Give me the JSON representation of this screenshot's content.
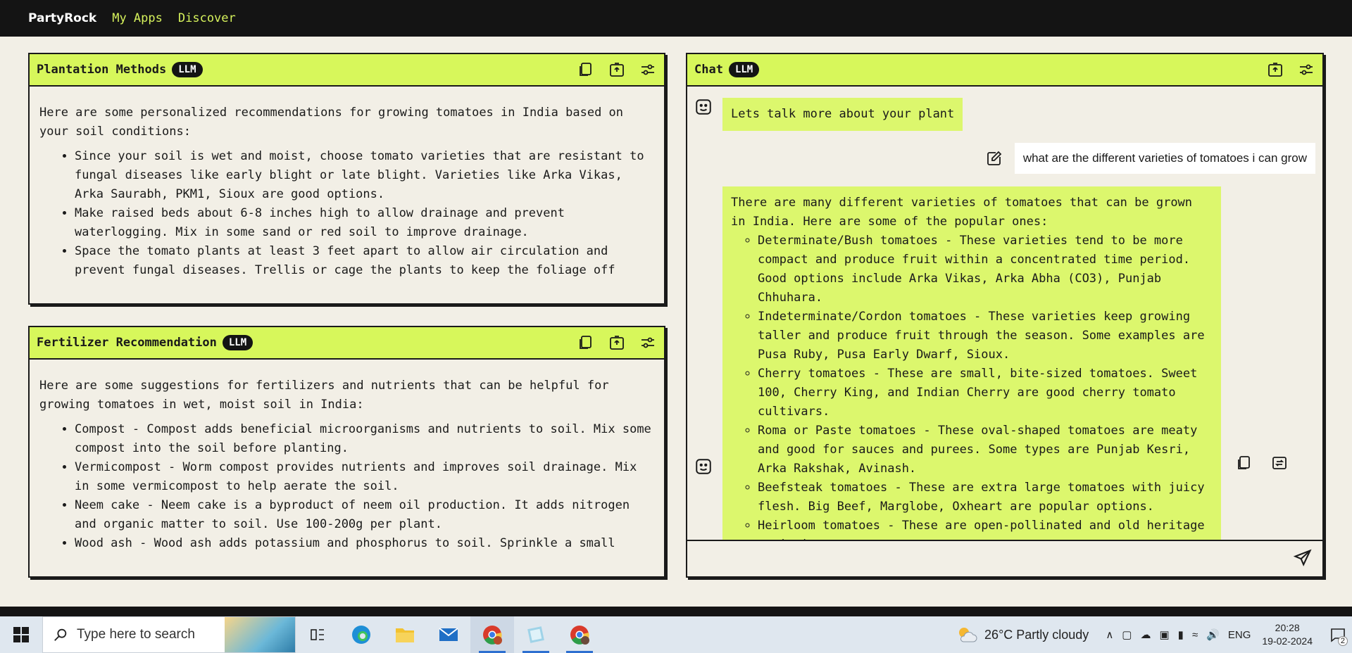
{
  "nav": {
    "brand": "PartyRock",
    "links": [
      "My Apps",
      "Discover"
    ]
  },
  "panels": {
    "plantation": {
      "title": "Plantation Methods",
      "badge": "LLM",
      "intro": "Here are some personalized recommendations for growing tomatoes in India based on your soil conditions:",
      "bullets": [
        "Since your soil is wet and moist, choose tomato varieties that are resistant to fungal diseases like early blight or late blight. Varieties like Arka Vikas, Arka Saurabh, PKM1, Sioux are good options.",
        "Make raised beds about 6-8 inches high to allow drainage and prevent waterlogging. Mix in some sand or red soil to improve drainage.",
        "Space the tomato plants at least 3 feet apart to allow air circulation and prevent fungal diseases. Trellis or cage the plants to keep the foliage off"
      ]
    },
    "fertilizer": {
      "title": "Fertilizer Recommendation",
      "badge": "LLM",
      "intro": "Here are some suggestions for fertilizers and nutrients that can be helpful for growing tomatoes in wet, moist soil in India:",
      "bullets": [
        "Compost - Compost adds beneficial microorganisms and nutrients to soil. Mix some compost into the soil before planting.",
        "Vermicompost - Worm compost provides nutrients and improves soil drainage. Mix in some vermicompost to help aerate the soil.",
        "Neem cake - Neem cake is a byproduct of neem oil production. It adds nitrogen and organic matter to soil. Use 100-200g per plant.",
        "Wood ash - Wood ash adds potassium and phosphorus to soil. Sprinkle a small"
      ]
    },
    "chat": {
      "title": "Chat",
      "badge": "LLM",
      "bot_greeting": "Lets talk more about your plant",
      "user_message": "what are the different varieties of tomatoes i can grow",
      "bot_intro": "There are many different varieties of tomatoes that can be grown in India. Here are some of the popular ones:",
      "bot_bullets": [
        "Determinate/Bush tomatoes - These varieties tend to be more compact and produce fruit within a concentrated time period. Good options include Arka Vikas, Arka Abha (CO3), Punjab Chhuhara.",
        "Indeterminate/Cordon tomatoes - These varieties keep growing taller and produce fruit through the season. Some examples are Pusa Ruby, Pusa Early Dwarf, Sioux.",
        "Cherry tomatoes - These are small, bite-sized tomatoes. Sweet 100, Cherry King, and Indian Cherry are good cherry tomato cultivars.",
        "Roma or Paste tomatoes - These oval-shaped tomatoes are meaty and good for sauces and purees. Some types are Punjab Kesri, Arka Rakshak, Avinash.",
        "Beefsteak tomatoes - These are extra large tomatoes with juicy flesh. Big Beef, Marglobe, Oxheart are popular options.",
        "Heirloom tomatoes - These are open-pollinated and old heritage varieties."
      ],
      "input_placeholder": ""
    }
  },
  "taskbar": {
    "search_placeholder": "Type here to search",
    "weather": "26°C  Partly cloudy",
    "lang": "ENG",
    "time": "20:28",
    "date": "19-02-2024",
    "notifications": "2"
  },
  "colors": {
    "accent": "#d7f75b",
    "dark": "#141414",
    "background": "#f2efe6",
    "nav_link": "#d6f25c"
  }
}
